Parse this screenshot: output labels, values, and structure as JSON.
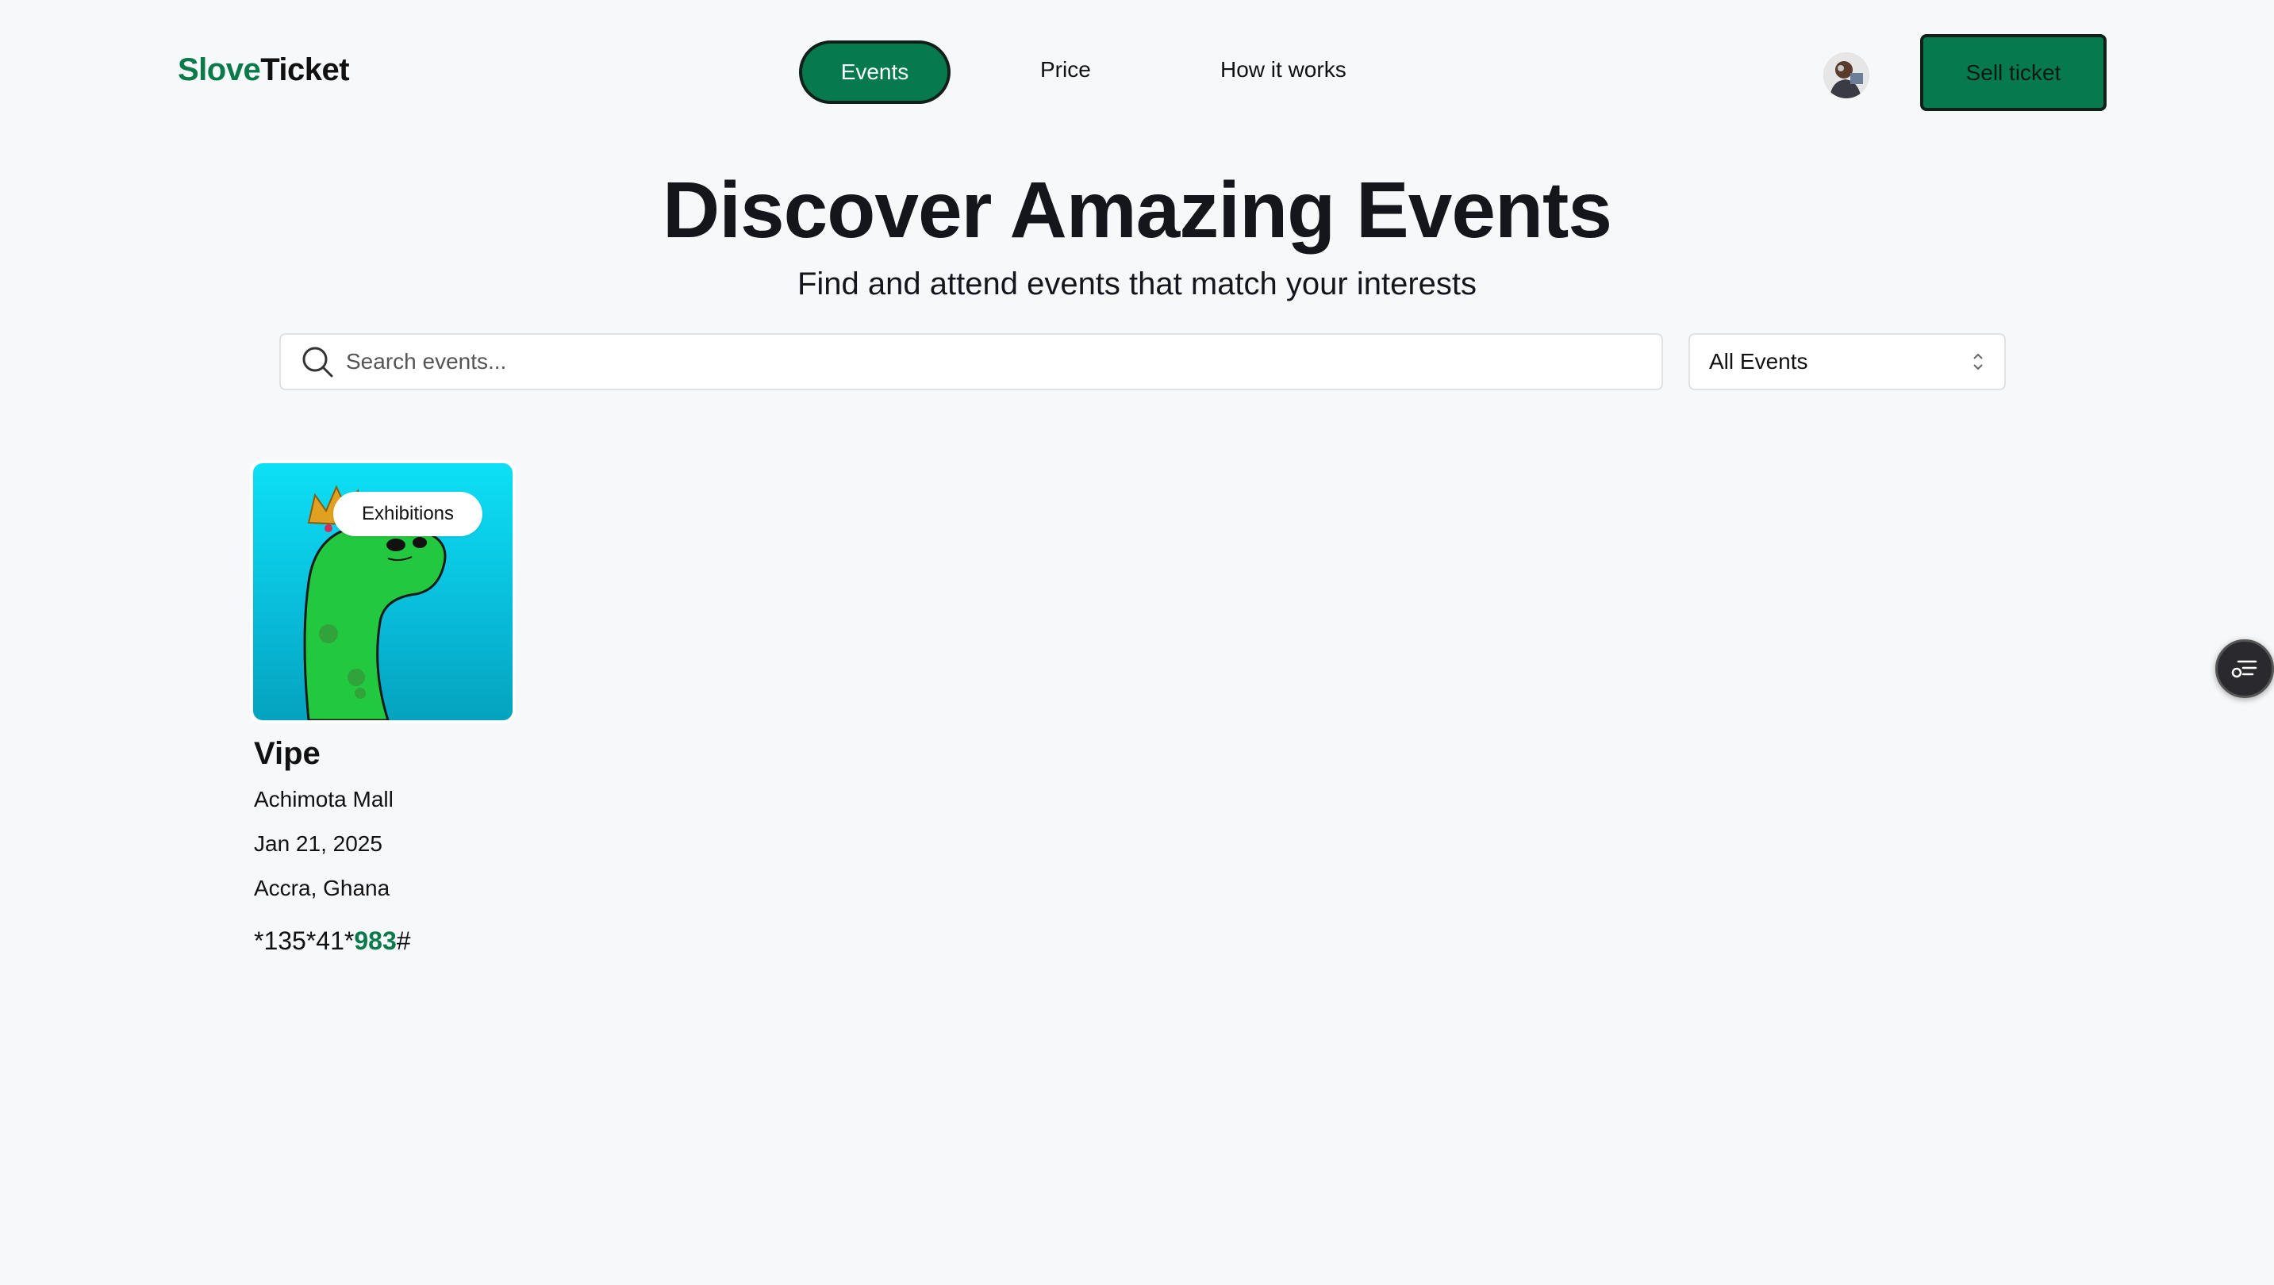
{
  "header": {
    "logo_part1": "Slove",
    "logo_part2": "Ticket",
    "nav": [
      "Events",
      "Price",
      "How it works"
    ],
    "sell_button": "Sell ticket"
  },
  "hero": {
    "title": "Discover Amazing Events",
    "subtitle": "Find and attend events that match your interests"
  },
  "search": {
    "placeholder": "Search events...",
    "value": ""
  },
  "filter": {
    "selected": "All Events"
  },
  "events": [
    {
      "category": "Exhibitions",
      "title": "Vipe",
      "venue": "Achimota Mall",
      "date": "Jan 21, 2025",
      "location": "Accra, Ghana",
      "code_prefix": "*135*41*",
      "code_highlight": "983",
      "code_suffix": "#"
    }
  ],
  "colors": {
    "brand_green": "#067a4e",
    "background": "#f7f8fa"
  },
  "icons": [
    "search-icon",
    "chevron-updown-icon",
    "list-filter-icon"
  ]
}
